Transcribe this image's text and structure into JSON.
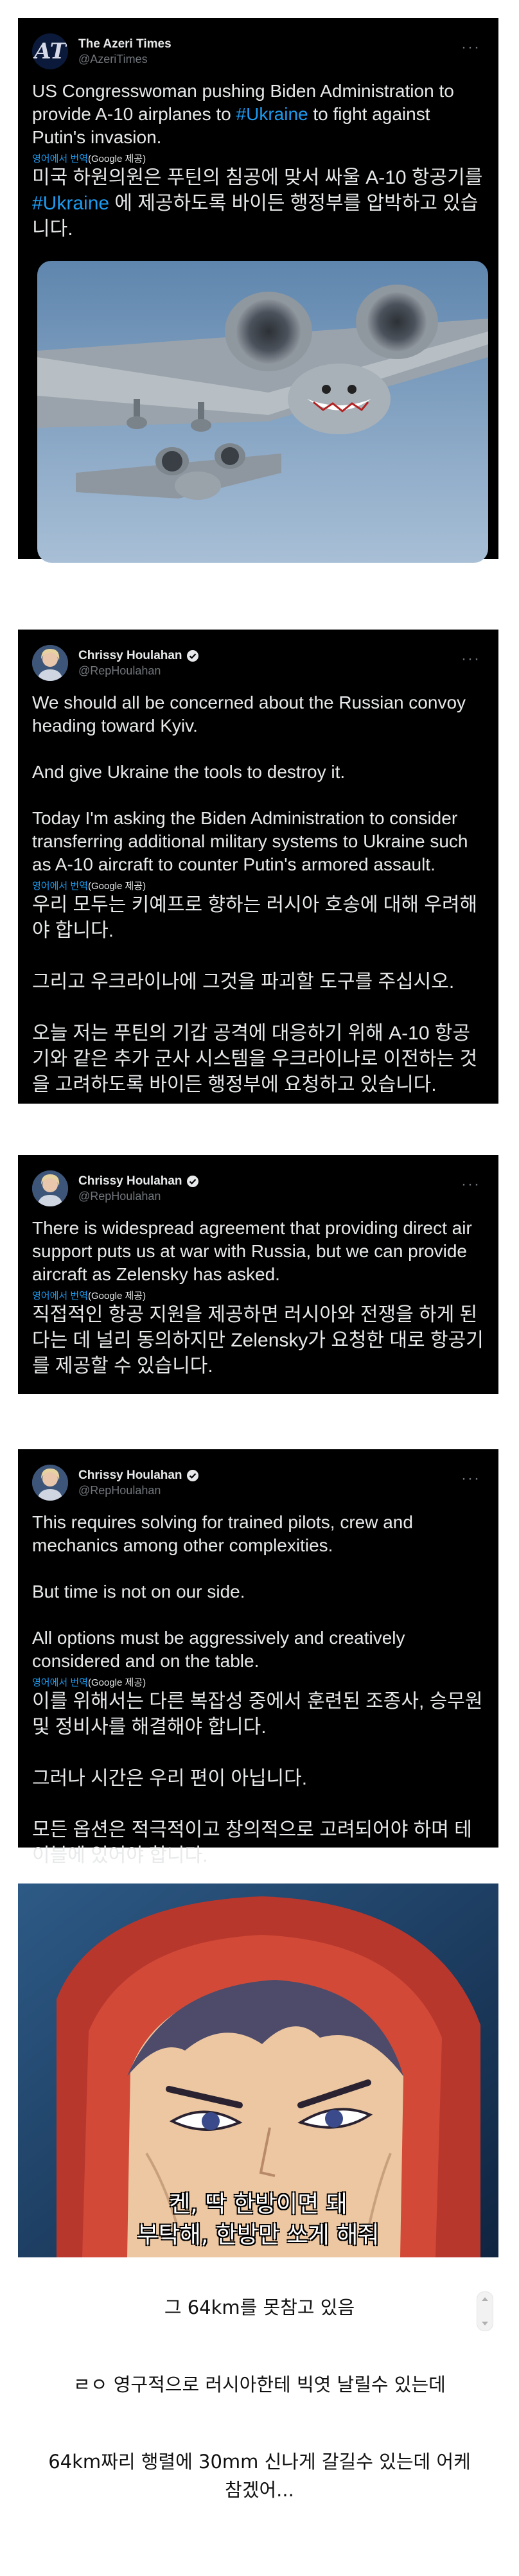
{
  "tweets": [
    {
      "name": "The Azeri Times",
      "handle": "@AzeriTimes",
      "avatar_text": "AT",
      "text_before": "US Congresswoman pushing Biden Administration to provide A-10 airplanes to ",
      "hashtag": "#Ukraine",
      "text_after": " to fight against Putin's invasion.",
      "translate_link": "영어에서 번역",
      "translate_source": "(Google 제공)",
      "ko_before": "미국 하원의원은 푸틴의 침공에 맞서 싸울 A-10 항공기를 ",
      "ko_hashtag": "#Ukraine",
      "ko_after": " 에 제공하도록 바이든 행정부를 압박하고 있습니다."
    },
    {
      "name": "Chrissy Houlahan",
      "handle": "@RepHoulahan",
      "text": "We should all be concerned about the Russian convoy heading toward Kyiv.\n\nAnd give Ukraine the tools to destroy it.\n\nToday I'm asking the Biden Administration to consider transferring additional military systems to Ukraine such as A-10 aircraft to counter Putin's armored assault.",
      "translate_link": "영어에서 번역",
      "translate_source": "(Google 제공)",
      "ko": "우리 모두는 키예프로 향하는 러시아 호송에 대해 우려해야 합니다.\n\n그리고 우크라이나에 그것을 파괴할 도구를 주십시오.\n\n오늘 저는 푸틴의 기갑 공격에 대응하기 위해 A-10 항공기와 같은 추가 군사 시스템을 우크라이나로 이전하는 것을 고려하도록 바이든 행정부에 요청하고 있습니다."
    },
    {
      "name": "Chrissy Houlahan",
      "handle": "@RepHoulahan",
      "text": "There is widespread agreement that providing direct air support puts us at war with Russia, but we can provide aircraft as Zelensky has asked.",
      "translate_link": "영어에서 번역",
      "translate_source": "(Google 제공)",
      "ko": "직접적인 항공 지원을 제공하면 러시아와 전쟁을 하게 된다는 데 널리 동의하지만 Zelensky가 요청한 대로 항공기를 제공할 수 있습니다."
    },
    {
      "name": "Chrissy Houlahan",
      "handle": "@RepHoulahan",
      "text": "This requires solving for trained pilots, crew and mechanics among other complexities.\n\nBut time is not on our side.\n\nAll options must be aggressively and creatively considered and on the table.",
      "translate_link": "영어에서 번역",
      "translate_source": "(Google 제공)",
      "ko": "이를 위해서는 다른 복잡성 중에서 훈련된 조종사, 승무원 및 정비사를 해결해야 합니다.\n\n그러나 시간은 우리 편이 아닙니다.\n\n모든 옵션은 적극적이고 창의적으로 고려되어야 하며 테이블에 있어야 합니다."
    }
  ],
  "meme": {
    "caption_line1": "켄, 딱 한방이면 돼",
    "caption_line2": "부탁해, 한방만 쏘게 해줘"
  },
  "comments": [
    "그 64km를 못참고 있음",
    "ㄹㅇ 영구적으로 러시아한테 빅엿 날릴수 있는데",
    "64km짜리 행렬에 30mm 신나게 갈길수 있는데 어케 참겠어..."
  ],
  "colors": {
    "tweet_bg": "#000000",
    "text": "#e7e9ea",
    "muted": "#71767b",
    "link": "#1d9bf0"
  }
}
